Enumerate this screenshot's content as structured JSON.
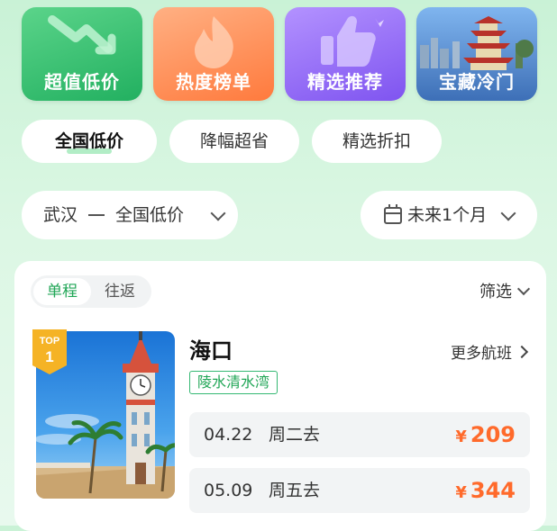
{
  "categories": [
    {
      "label": "超值低价",
      "icon": "down-trend-icon"
    },
    {
      "label": "热度榜单",
      "icon": "flame-icon"
    },
    {
      "label": "精选推荐",
      "icon": "thumbs-up-icon"
    },
    {
      "label": "宝藏冷门",
      "icon": "pagoda-photo"
    }
  ],
  "filters": {
    "chips": [
      "全国低价",
      "降幅超省",
      "精选折扣"
    ],
    "active_chip": "全国低价"
  },
  "route": {
    "from": "武汉",
    "to": "全国低价"
  },
  "date_range": {
    "label": "未来1个月"
  },
  "card": {
    "segments": [
      "单程",
      "往返"
    ],
    "active_segment": "单程",
    "filter_label": "筛选",
    "item": {
      "rank_badge": {
        "top": "TOP",
        "number": "1"
      },
      "destination": "海口",
      "more_label": "更多航班",
      "tag": "陵水清水湾",
      "flights": [
        {
          "date": "04.22",
          "weekday": "周二去",
          "currency": "¥",
          "price": "209"
        },
        {
          "date": "05.09",
          "weekday": "周五去",
          "currency": "¥",
          "price": "344"
        }
      ]
    }
  },
  "colors": {
    "accent_green": "#20a656",
    "price_orange": "#ff6a2b",
    "badge_gold": "#f5b325"
  }
}
